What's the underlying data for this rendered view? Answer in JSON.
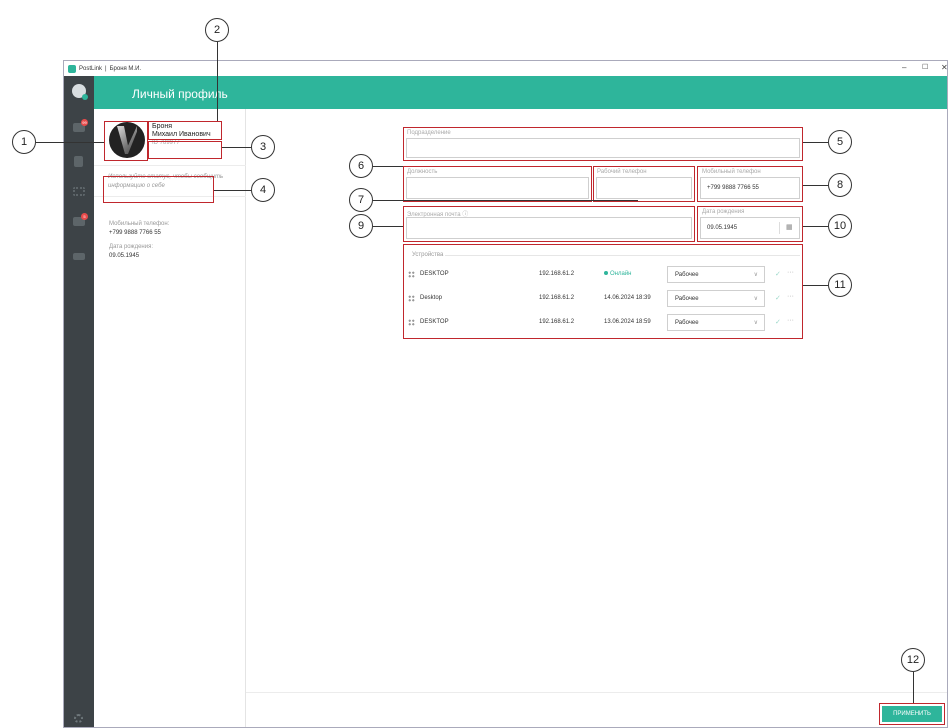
{
  "window": {
    "app_name": "PostLink",
    "separator": "|",
    "user_short": "Броня М.И.",
    "controls": [
      "–",
      "☐",
      "✕"
    ]
  },
  "rail": {
    "badges": [
      "99",
      "5"
    ]
  },
  "header": {
    "title": "Личный профиль"
  },
  "profile": {
    "last_name": "Броня",
    "first_names": "Михаил Иванович",
    "id": "ID 789977",
    "status_hint": "Используйте статус, чтобы сообщить информацию о себе",
    "mobile_label": "Мобильный телефон:",
    "mobile_value": "+799 9888 7766 55",
    "birth_label": "Дата рождения:",
    "birth_value": "09.05.1945"
  },
  "form": {
    "department_label": "Подразделение",
    "department_value": "",
    "position_label": "Должность",
    "position_value": "",
    "work_phone_label": "Рабочий телефон",
    "work_phone_value": "",
    "mobile_label": "Мобильный телефон",
    "mobile_value": "+799 9888 7766 55",
    "email_label": "Электронная почта",
    "email_info": "ⓘ",
    "email_value": "",
    "birth_label": "Дата рождения",
    "birth_value": "09.05.1945"
  },
  "devices": {
    "header": "Устройства",
    "rows": [
      {
        "name": "DESKTOP",
        "ip": "192.168.61.2",
        "status": "Онлайн",
        "online": true,
        "mode": "Рабочее"
      },
      {
        "name": "Desktop",
        "ip": "192.168.61.2",
        "status": "14.06.2024 18:39",
        "online": false,
        "mode": "Рабочее"
      },
      {
        "name": "DESKTOP",
        "ip": "192.168.61.2",
        "status": "13.06.2024 18:59",
        "online": false,
        "mode": "Рабочее"
      }
    ]
  },
  "apply_label": "ПРИМЕНИТЬ",
  "callouts": [
    "1",
    "2",
    "3",
    "4",
    "5",
    "6",
    "7",
    "8",
    "9",
    "10",
    "11",
    "12"
  ],
  "colors": {
    "accent": "#2eb59b",
    "rail": "#3d4347",
    "highlight": "#c0272d"
  }
}
